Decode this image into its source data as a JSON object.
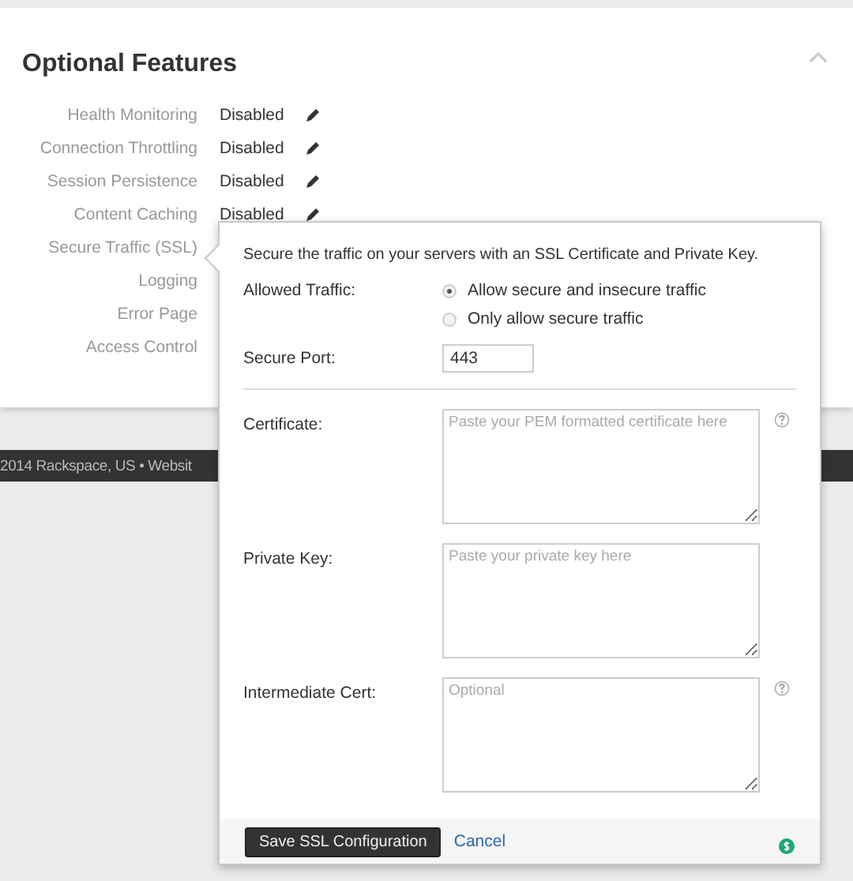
{
  "title": "Optional Features",
  "features": [
    {
      "label": "Health Monitoring",
      "value": "Disabled"
    },
    {
      "label": "Connection Throttling",
      "value": "Disabled"
    },
    {
      "label": "Session Persistence",
      "value": "Disabled"
    },
    {
      "label": "Content Caching",
      "value": "Disabled"
    },
    {
      "label": "Secure Traffic (SSL)"
    },
    {
      "label": "Logging"
    },
    {
      "label": "Error Page"
    },
    {
      "label": "Access Control"
    }
  ],
  "footer": "2014 Rackspace, US • Websit",
  "popover": {
    "intro": "Secure the traffic on your servers with an SSL Certificate and Private Key.",
    "traffic_label": "Allowed Traffic:",
    "traffic_options": [
      {
        "label": "Allow secure and insecure traffic",
        "selected": true
      },
      {
        "label": "Only allow secure traffic",
        "selected": false
      }
    ],
    "port_label": "Secure Port:",
    "port_value": "443",
    "fields": [
      {
        "label": "Certificate:",
        "placeholder": "Paste your PEM formatted certificate here",
        "help": true
      },
      {
        "label": "Private Key:",
        "placeholder": "Paste your private key here",
        "help": false
      },
      {
        "label": "Intermediate Cert:",
        "placeholder": "Optional",
        "help": true
      }
    ],
    "save": "Save SSL Configuration",
    "cancel": "Cancel"
  }
}
